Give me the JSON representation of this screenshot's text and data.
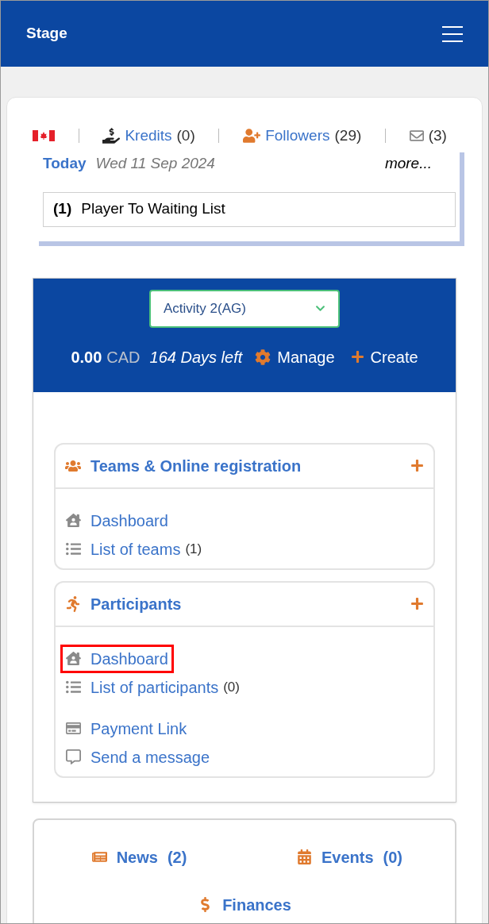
{
  "header": {
    "title": "Stage"
  },
  "stats": {
    "kredits": {
      "label": "Kredits",
      "count": "(0)"
    },
    "followers": {
      "label": "Followers",
      "count": "(29)"
    },
    "messages": {
      "count": "(3)"
    }
  },
  "today": {
    "label": "Today",
    "date": "Wed 11 Sep 2024",
    "more": "more...",
    "items": [
      {
        "number": "(1)",
        "text": "Player To Waiting List"
      }
    ]
  },
  "activity": {
    "select": "Activity 2(AG)",
    "amount": "0.00",
    "currency": "CAD",
    "days_left": "164 Days left",
    "manage": "Manage",
    "create": "Create"
  },
  "sections": [
    {
      "kind": "teams",
      "title": "Teams & Online registration",
      "links": [
        {
          "kind": "dashboard",
          "label": "Dashboard",
          "highlighted": false
        },
        {
          "kind": "list",
          "label": "List of teams",
          "count": "(1)",
          "highlighted": false
        }
      ]
    },
    {
      "kind": "participants",
      "title": "Participants",
      "links": [
        {
          "kind": "dashboard",
          "label": "Dashboard",
          "highlighted": true
        },
        {
          "kind": "list",
          "label": "List of participants",
          "count": "(0)",
          "highlighted": false
        },
        {
          "kind": "payment",
          "label": "Payment Link",
          "highlighted": false
        },
        {
          "kind": "message",
          "label": "Send a message",
          "highlighted": false
        }
      ]
    }
  ],
  "bottom": [
    {
      "kind": "news",
      "label": "News",
      "count": "(2)"
    },
    {
      "kind": "events",
      "label": "Events",
      "count": "(0)"
    },
    {
      "kind": "finances",
      "label": "Finances"
    }
  ]
}
